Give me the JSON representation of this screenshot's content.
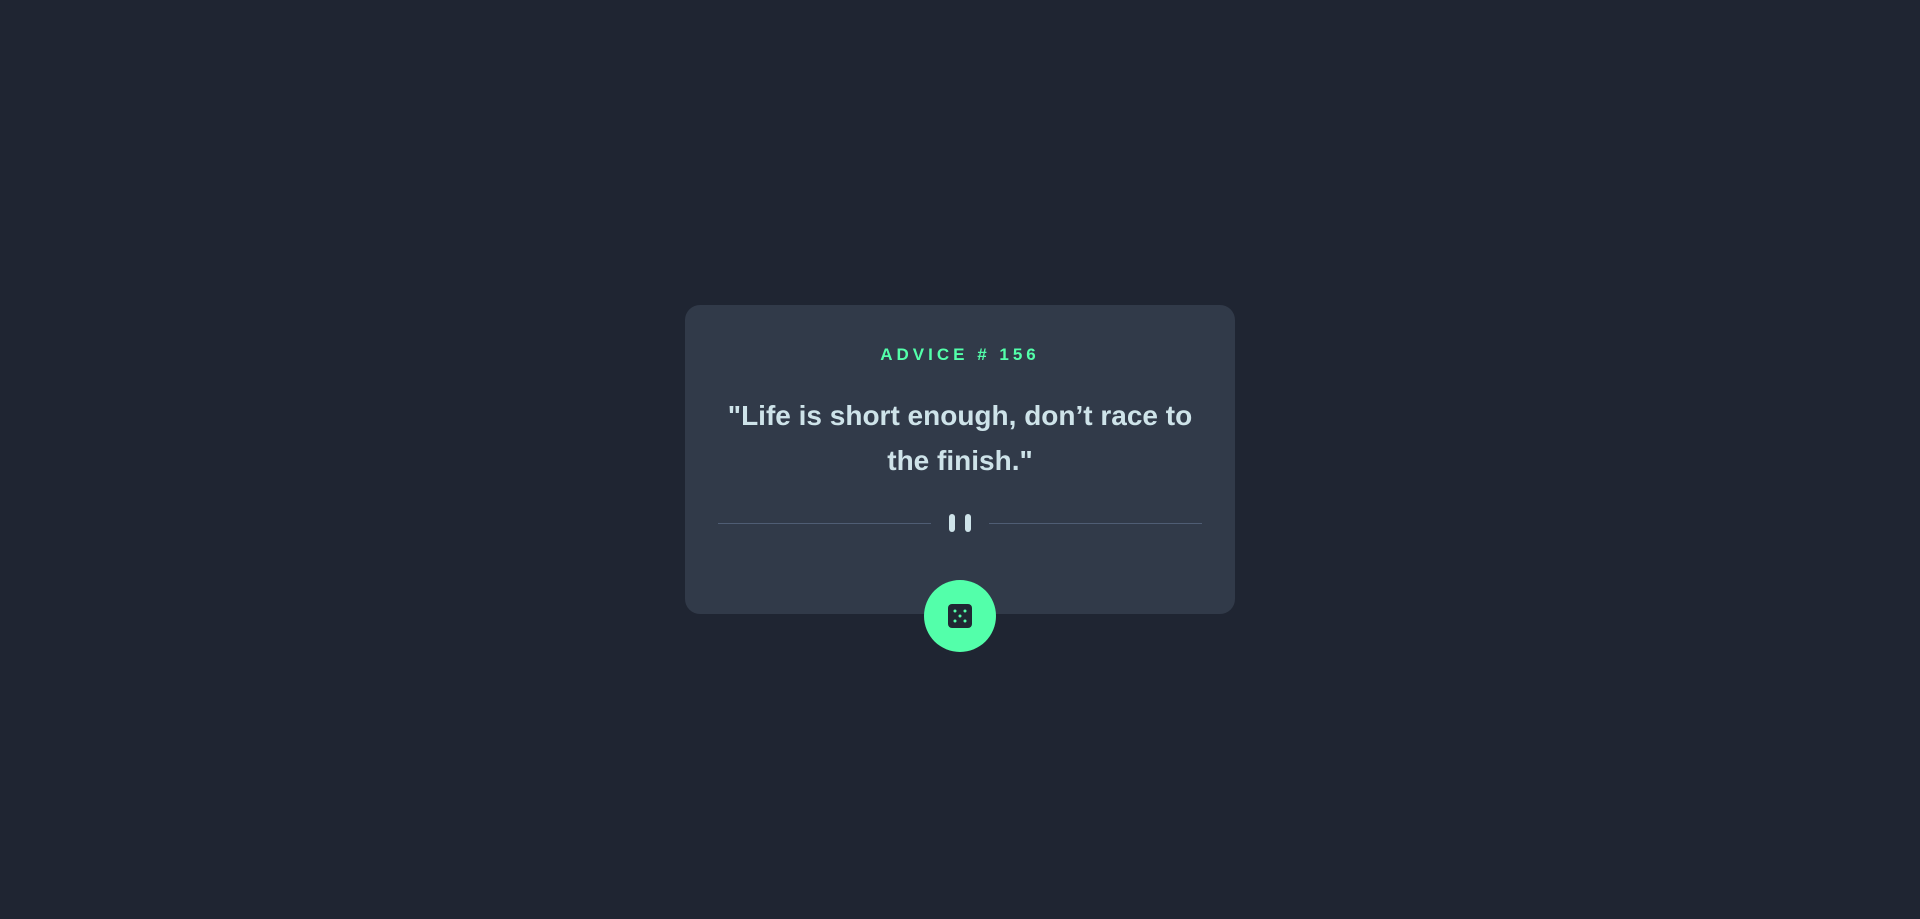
{
  "card": {
    "advice_number": "ADVICE # 156",
    "advice_text": "\"Life is short enough, don’t race to the finish.\""
  },
  "icons": {
    "divider": "pause-icon",
    "button": "dice-icon"
  },
  "colors": {
    "background": "#1f2532",
    "card": "#313a49",
    "accent": "#53ffaa",
    "text": "#cee3e9",
    "divider": "#4f5d74"
  }
}
